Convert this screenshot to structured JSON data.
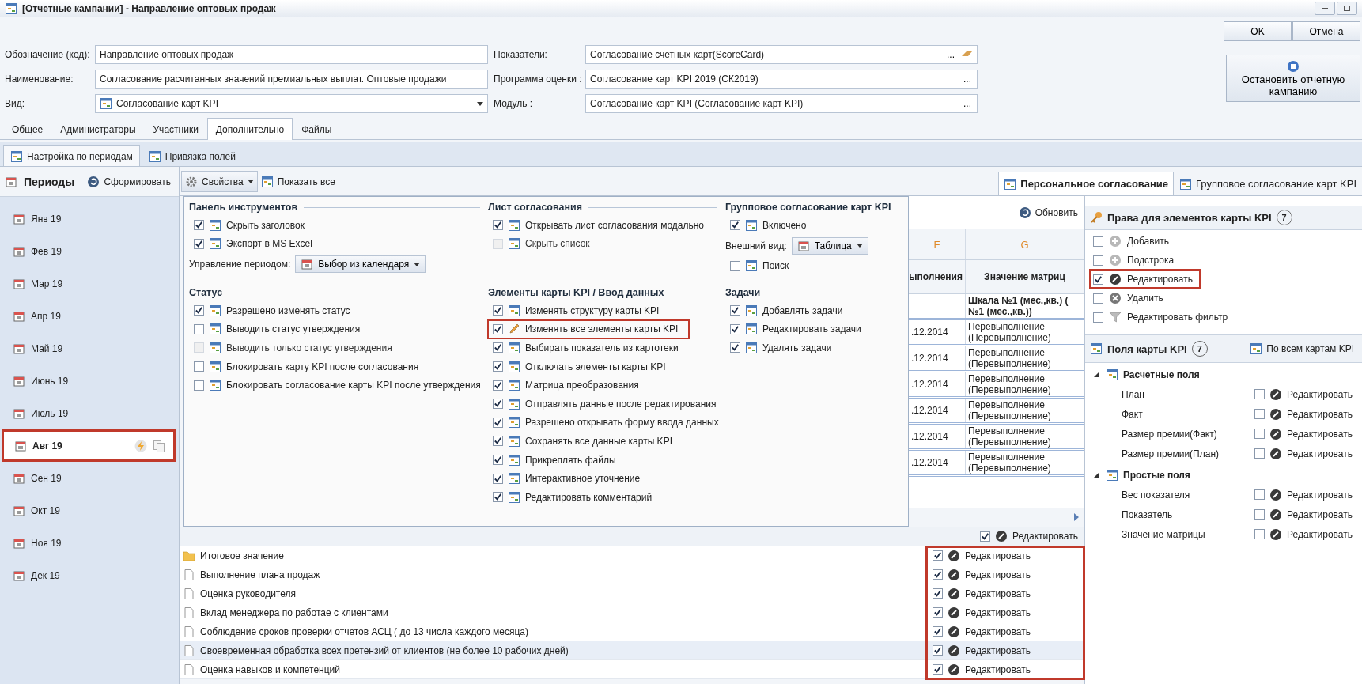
{
  "window": {
    "title": "[Отчетные кампании] - Направление оптовых продаж"
  },
  "header": {
    "fields_left": [
      {
        "label": "Обозначение (код):",
        "value": "Направление оптовых продаж",
        "kind": "text"
      },
      {
        "label": "Наименование:",
        "value": "Согласование расчитанных значений премиальных выплат. Оптовые продажи",
        "kind": "text"
      },
      {
        "label": "Вид:",
        "value": "Согласование карт KPI",
        "kind": "combo"
      }
    ],
    "fields_right": [
      {
        "label": "Показатели:",
        "value": "Согласование счетных карт(ScoreCard)",
        "button": "...",
        "kind": "lookup_clear"
      },
      {
        "label": "Программа оценки :",
        "value": "Согласование карт KPI 2019 (СК2019)",
        "button": "...",
        "kind": "lookup"
      },
      {
        "label": "Модуль :",
        "value": "Согласование карт KPI (Согласование карт KPI)",
        "button": "...",
        "kind": "lookup"
      }
    ],
    "buttons": [
      "OK",
      "Отмена"
    ],
    "stop_button": "Остановить отчетную кампанию"
  },
  "tabs": [
    {
      "label": "Общее",
      "selected": false
    },
    {
      "label": "Администраторы",
      "selected": false
    },
    {
      "label": "Участники",
      "selected": false
    },
    {
      "label": "Дополнительно",
      "selected": true
    },
    {
      "label": "Файлы",
      "selected": false
    }
  ],
  "subtabs": [
    {
      "label": "Настройка по периодам",
      "selected": true
    },
    {
      "label": "Привязка полей",
      "selected": false
    }
  ],
  "periods": {
    "title": "Периоды",
    "action": "Сформировать",
    "items": [
      {
        "label": "Янв 19",
        "selected": false
      },
      {
        "label": "Фев 19",
        "selected": false
      },
      {
        "label": "Мар 19",
        "selected": false
      },
      {
        "label": "Апр 19",
        "selected": false
      },
      {
        "label": "Май 19",
        "selected": false
      },
      {
        "label": "Июнь 19",
        "selected": false
      },
      {
        "label": "Июль 19",
        "selected": false
      },
      {
        "label": "Авг 19",
        "selected": true
      },
      {
        "label": "Сен 19",
        "selected": false
      },
      {
        "label": "Окт 19",
        "selected": false
      },
      {
        "label": "Ноя 19",
        "selected": false
      },
      {
        "label": "Дек 19",
        "selected": false
      }
    ]
  },
  "toolbar": {
    "properties": "Свойства",
    "show_all": "Показать все"
  },
  "right_tabs": [
    {
      "label": "Персональное согласование",
      "selected": true
    },
    {
      "label": "Групповое согласование карт KPI",
      "selected": false
    }
  ],
  "popup": {
    "sections": [
      {
        "title": "Панель инструментов",
        "items": [
          {
            "kind": "check",
            "label": "Скрыть заголовок",
            "checked": true
          },
          {
            "kind": "check",
            "label": "Экспорт в MS Excel",
            "checked": true
          },
          {
            "kind": "combo",
            "label": "Управление периодом:",
            "value": "Выбор из календаря"
          }
        ]
      },
      {
        "title": "Лист согласования",
        "items": [
          {
            "kind": "check",
            "label": "Открывать лист согласования модально",
            "checked": true,
            "disabled": false
          },
          {
            "kind": "check",
            "label": "Скрыть список",
            "checked": false,
            "disabled": true
          }
        ]
      },
      {
        "title": "Групповое согласование карт KPI",
        "items": [
          {
            "kind": "check",
            "label": "Включено",
            "checked": true
          },
          {
            "kind": "combo",
            "label": "Внешний вид:",
            "value": "Таблица"
          },
          {
            "kind": "check",
            "label": "Поиск",
            "checked": false
          }
        ]
      },
      {
        "title": "Статус",
        "items": [
          {
            "kind": "check",
            "label": "Разрешено изменять статус",
            "checked": true,
            "disabled": false
          },
          {
            "kind": "check",
            "label": "Выводить статус утверждения",
            "checked": false,
            "disabled": false
          },
          {
            "kind": "check",
            "label": "Выводить только статус утверждения",
            "checked": false,
            "disabled": true
          },
          {
            "kind": "check",
            "label": "Блокировать карту KPI после согласования",
            "checked": false,
            "disabled": false
          },
          {
            "kind": "check",
            "label": "Блокировать согласование карты KPI после утверждения",
            "checked": false,
            "disabled": false
          }
        ]
      },
      {
        "title": "Элементы карты KPI / Ввод данных",
        "items": [
          {
            "kind": "check",
            "label": "Изменять структуру карты KPI",
            "checked": true,
            "highlighted": false
          },
          {
            "kind": "check",
            "label": "Изменять все элементы карты KPI",
            "checked": true,
            "highlighted": true
          },
          {
            "kind": "check",
            "label": "Выбирать показатель из картотеки",
            "checked": true,
            "highlighted": false
          },
          {
            "kind": "check",
            "label": "Отключать элементы карты KPI",
            "checked": true,
            "highlighted": false
          },
          {
            "kind": "check",
            "label": "Матрица преобразования",
            "checked": true,
            "highlighted": false
          },
          {
            "kind": "check",
            "label": "Отправлять данные после редактирования",
            "checked": true,
            "highlighted": false
          },
          {
            "kind": "check",
            "label": "Разрешено открывать форму ввода данных",
            "checked": true,
            "highlighted": false
          },
          {
            "kind": "check",
            "label": "Сохранять все данные карты KPI",
            "checked": true,
            "highlighted": false
          },
          {
            "kind": "check",
            "label": "Прикреплять файлы",
            "checked": true,
            "highlighted": false
          },
          {
            "kind": "check",
            "label": "Интерактивное уточнение",
            "checked": true,
            "highlighted": false
          },
          {
            "kind": "check",
            "label": "Редактировать комментарий",
            "checked": true,
            "highlighted": false
          }
        ]
      },
      {
        "title": "Задачи",
        "items": [
          {
            "kind": "check",
            "label": "Добавлять задачи",
            "checked": true
          },
          {
            "kind": "check",
            "label": "Редактировать задачи",
            "checked": true
          },
          {
            "kind": "check",
            "label": "Удалять задачи",
            "checked": true
          }
        ]
      }
    ]
  },
  "grid": {
    "refresh": "Обновить",
    "columns": [
      {
        "letter": "F",
        "title": "ыполнения"
      },
      {
        "letter": "G",
        "title": "Значение матриц"
      }
    ],
    "group_lines": [
      "Шкала №1 (мес.,кв.) (",
      "№1 (мес.,кв.))"
    ],
    "rows": [
      {
        "date": ".12.2014",
        "value_lines": [
          "Перевыполнение",
          "(Перевыполнение)"
        ]
      },
      {
        "date": ".12.2014",
        "value_lines": [
          "Перевыполнение",
          "(Перевыполнение)"
        ]
      },
      {
        "date": ".12.2014",
        "value_lines": [
          "Перевыполнение",
          "(Перевыполнение)"
        ]
      },
      {
        "date": ".12.2014",
        "value_lines": [
          "Перевыполнение",
          "(Перевыполнение)"
        ]
      },
      {
        "date": ".12.2014",
        "value_lines": [
          "Перевыполнение",
          "(Перевыполнение)"
        ]
      },
      {
        "date": ".12.2014",
        "value_lines": [
          "Перевыполнение",
          "(Перевыполнение)"
        ]
      }
    ]
  },
  "elements": {
    "header_check": {
      "checked": true,
      "action": "Редактировать"
    },
    "highlighted": true,
    "rows": [
      {
        "label": "Итоговое значение",
        "kind": "folder",
        "selected": false,
        "checked": true,
        "action": "Редактировать"
      },
      {
        "label": "Выполнение плана продаж",
        "kind": "document",
        "selected": false,
        "checked": true,
        "action": "Редактировать"
      },
      {
        "label": "Оценка руководителя",
        "kind": "document",
        "selected": false,
        "checked": true,
        "action": "Редактировать"
      },
      {
        "label": "Вклад менеджера по работае с клиентами",
        "kind": "document",
        "selected": false,
        "checked": true,
        "action": "Редактировать"
      },
      {
        "label": "Соблюдение сроков проверки отчетов АСЦ  ( до 13 числа каждого месяца)",
        "kind": "document",
        "selected": false,
        "checked": true,
        "action": "Редактировать"
      },
      {
        "label": "Своевременная обработка всех претензий от клиентов (не более 10 рабочих дней)",
        "kind": "document",
        "selected": true,
        "checked": true,
        "action": "Редактировать"
      },
      {
        "label": "Оценка навыков и компетенций",
        "kind": "document",
        "selected": false,
        "checked": true,
        "action": "Редактировать"
      }
    ]
  },
  "rights": {
    "title": "Права для элементов карты KPI",
    "count": "7",
    "items": [
      {
        "label": "Добавить",
        "kind": "add",
        "checked": false,
        "highlighted": false
      },
      {
        "label": "Подстрока",
        "kind": "add",
        "checked": false,
        "highlighted": false
      },
      {
        "label": "Редактировать",
        "kind": "edit",
        "checked": true,
        "highlighted": true
      },
      {
        "label": "Удалить",
        "kind": "delete",
        "checked": false,
        "highlighted": false
      },
      {
        "label": "Редактировать фильтр",
        "kind": "filter",
        "checked": false,
        "highlighted": false
      }
    ]
  },
  "fields": {
    "title": "Поля карты KPI",
    "count": "7",
    "action": "По всем картам KPI",
    "groups": [
      {
        "title": "Расчетные поля",
        "expanded": true,
        "children": [
          {
            "label": "План",
            "checked": false,
            "action": "Редактировать"
          },
          {
            "label": "Факт",
            "checked": false,
            "action": "Редактировать"
          },
          {
            "label": "Размер премии(Факт)",
            "checked": false,
            "action": "Редактировать"
          },
          {
            "label": "Размер премии(План)",
            "checked": false,
            "action": "Редактировать"
          }
        ]
      },
      {
        "title": "Простые поля",
        "expanded": true,
        "children": [
          {
            "label": "Вес показателя",
            "checked": false,
            "action": "Редактировать"
          },
          {
            "label": "Показатель",
            "checked": false,
            "action": "Редактировать"
          },
          {
            "label": "Значение матрицы",
            "checked": false,
            "action": "Редактировать"
          }
        ]
      }
    ]
  }
}
